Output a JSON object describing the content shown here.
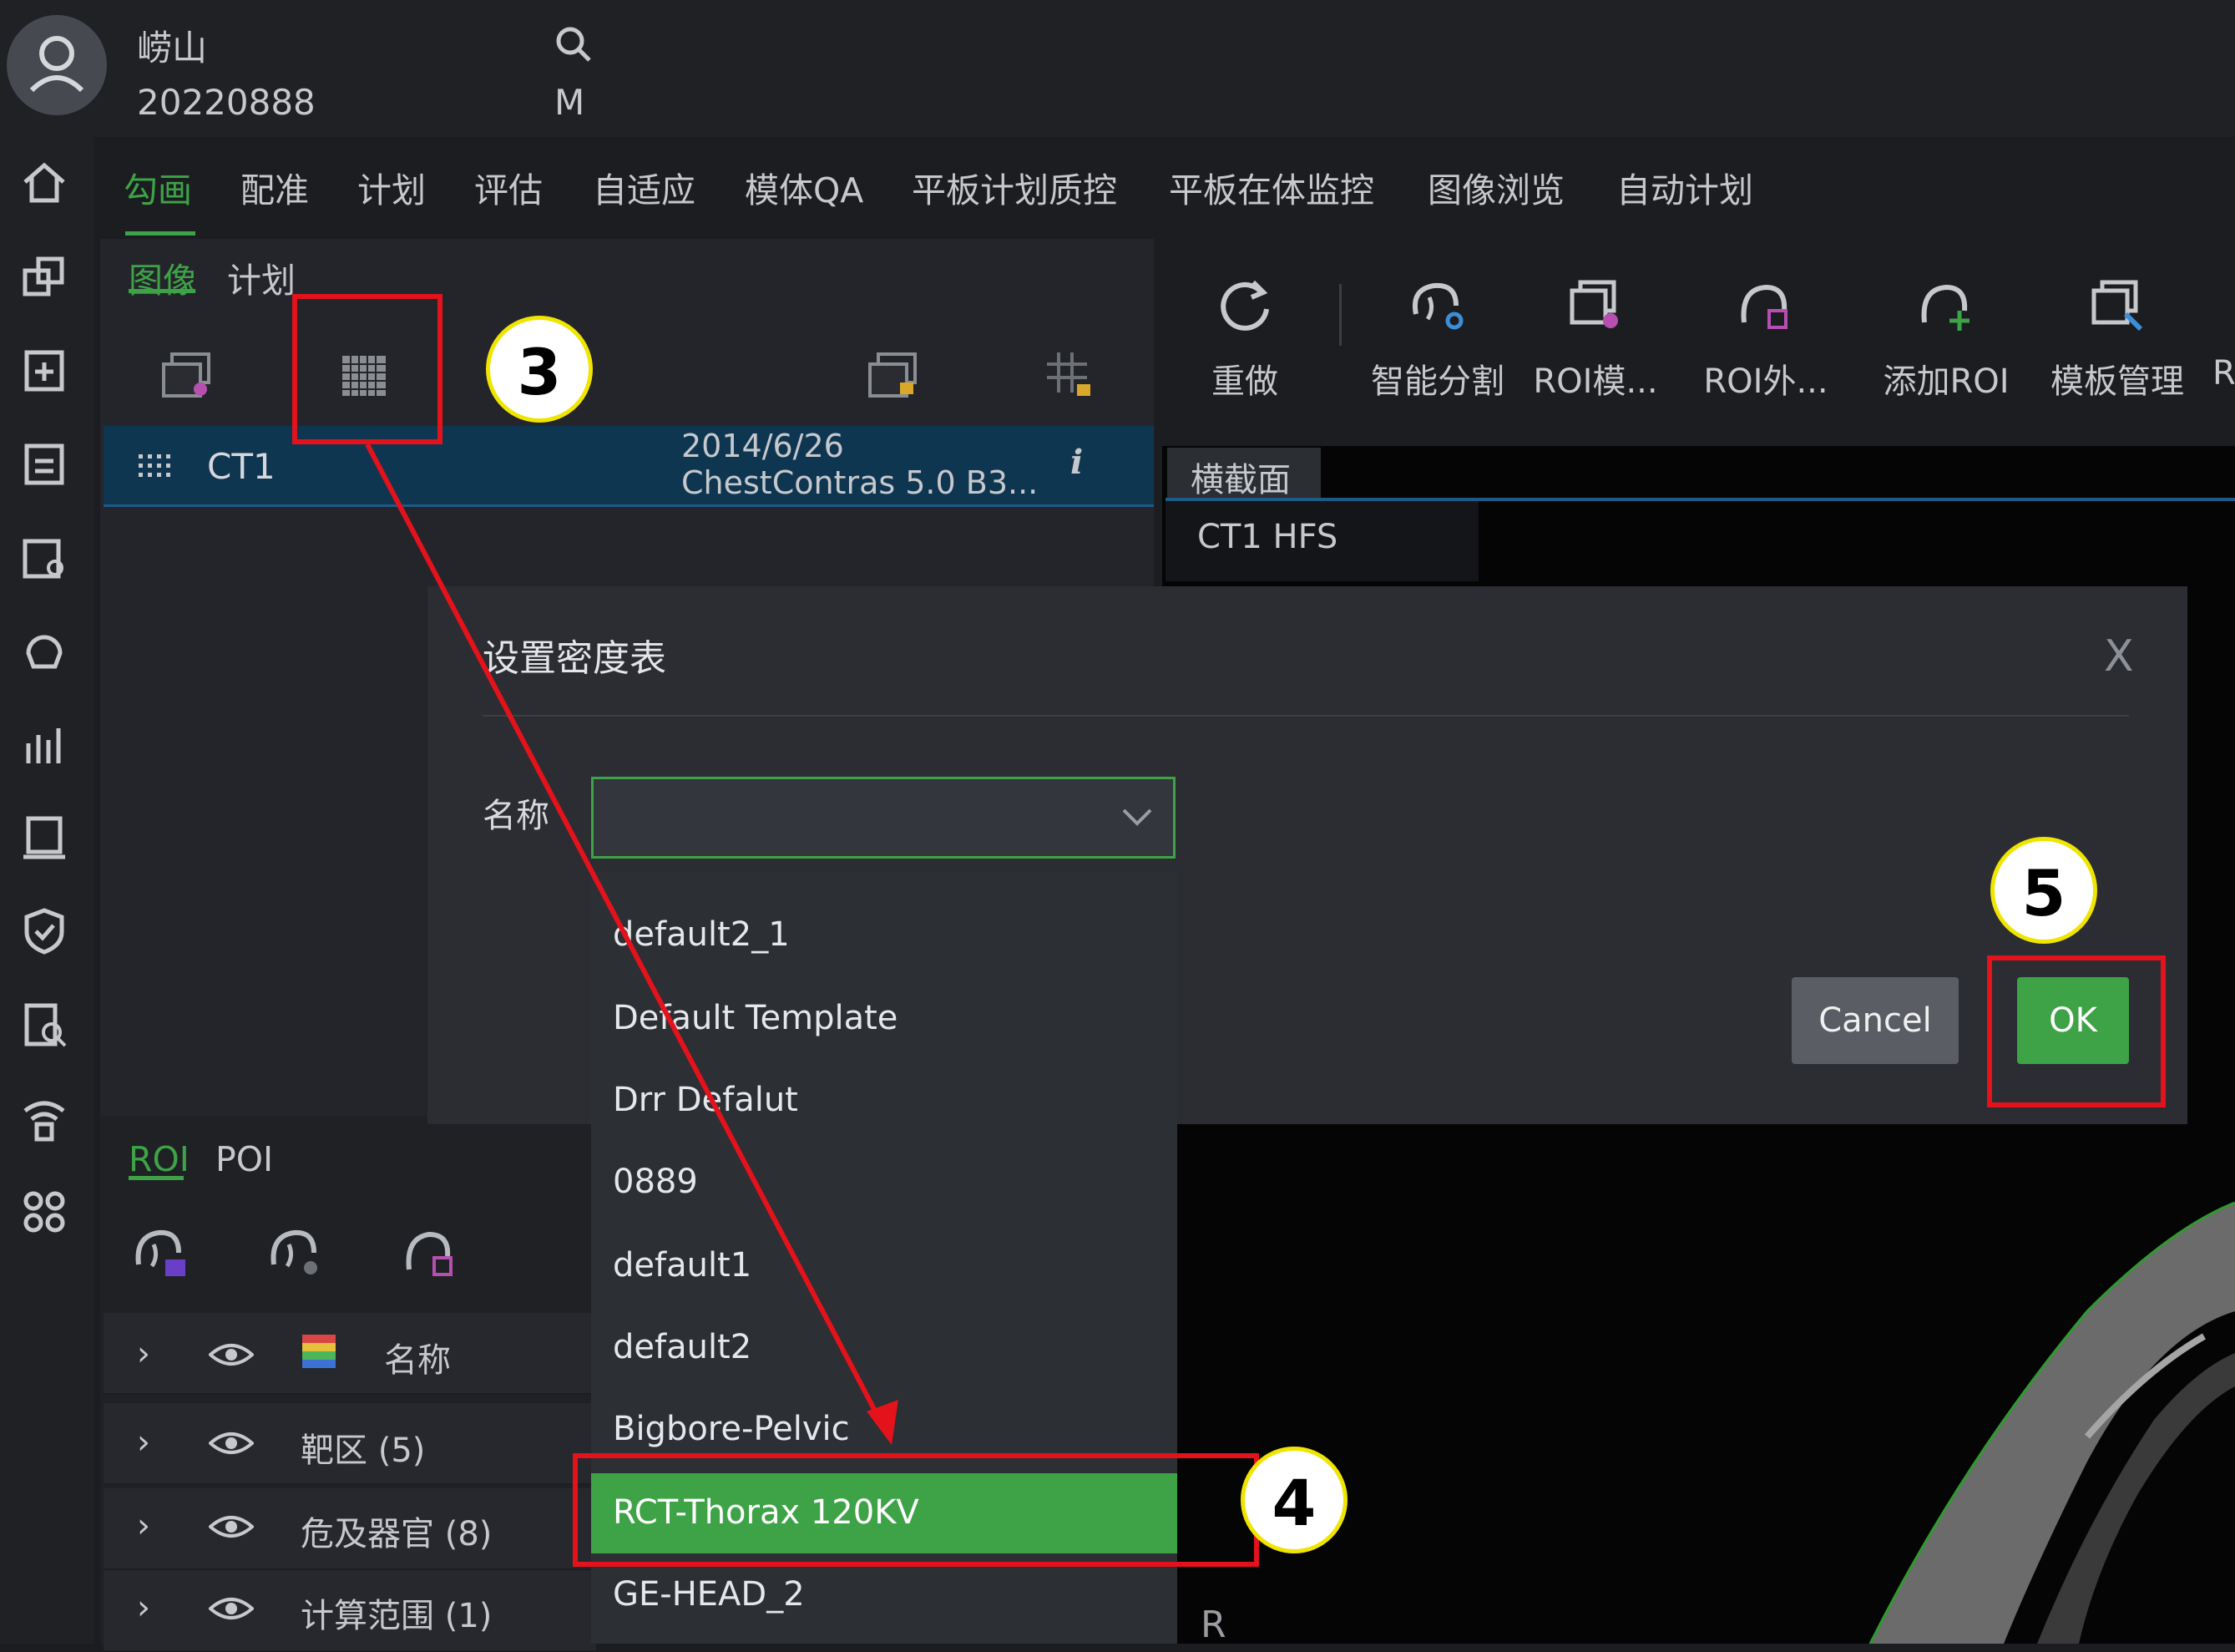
{
  "header": {
    "patient_name": "崂山",
    "patient_id": "20220888",
    "search_sex": "M"
  },
  "nav": {
    "tabs": [
      "勾画",
      "配准",
      "计划",
      "评估",
      "自适应",
      "模体QA",
      "平板计划质控",
      "平板在体监控",
      "图像浏览",
      "自动计划"
    ],
    "active_tab": "勾画"
  },
  "left_panel": {
    "tabs": [
      "图像",
      "计划"
    ],
    "active_tab": "图像",
    "image_row": {
      "name": "CT1",
      "date": "2014/6/26",
      "description": "ChestContras 5.0 B3..."
    }
  },
  "right_toolbar": {
    "items": [
      "重做",
      "智能分割",
      "ROI模...",
      "ROI外...",
      "添加ROI",
      "模板管理",
      "R"
    ]
  },
  "viewer": {
    "view_tab": "横截面",
    "image_info": "CT1 HFS",
    "orientation_label": "R"
  },
  "roi_panel": {
    "tabs": [
      "ROI",
      "POI"
    ],
    "active_tab": "ROI",
    "column_name": "名称",
    "rows": [
      "靶区 (5)",
      "危及器官 (8)",
      "计算范围 (1)"
    ]
  },
  "dialog": {
    "title": "设置密度表",
    "close_symbol": "X",
    "name_label": "名称",
    "select_value": "",
    "cancel_label": "Cancel",
    "ok_label": "OK",
    "options": [
      "default2_1",
      "Default Template",
      "Drr Defalut",
      "0889",
      "default1",
      "default2",
      "Bigbore-Pelvic",
      "RCT-Thorax 120KV",
      "GE-HEAD_2"
    ],
    "highlighted_option": "RCT-Thorax 120KV"
  },
  "annotations": {
    "step_numbers": [
      "3",
      "4",
      "5"
    ]
  },
  "colors": {
    "accent_green": "#3ea247",
    "annotation_red": "#e3121b",
    "annotation_yellow": "#f0e500",
    "selected_row_blue": "#0f3651"
  }
}
